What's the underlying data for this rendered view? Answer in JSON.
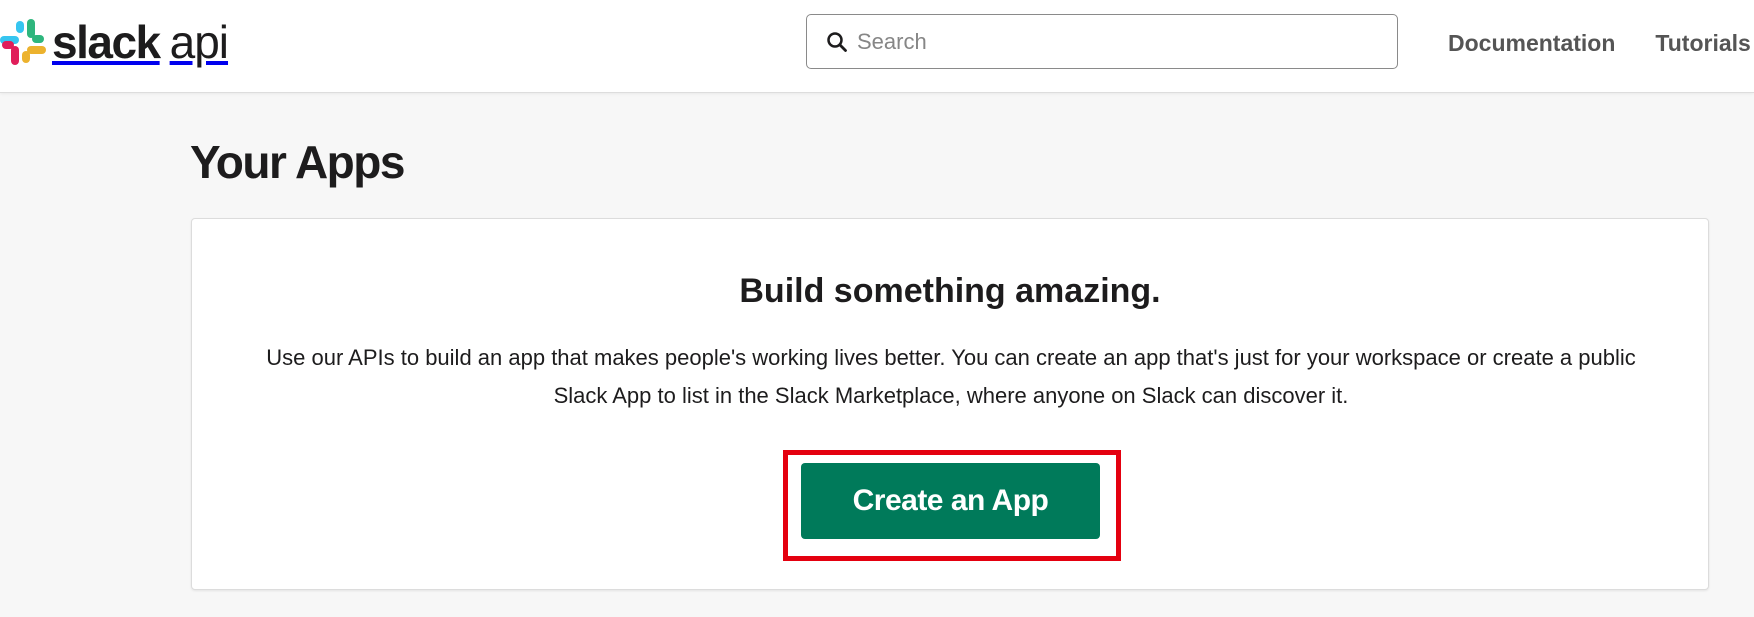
{
  "header": {
    "logo": {
      "word_slack": "slack",
      "word_api": "api",
      "colors": [
        "#36c5f0",
        "#2eb67d",
        "#ecb22e",
        "#e01e5a"
      ]
    },
    "search": {
      "placeholder": "Search",
      "value": "",
      "icon": "search-icon"
    },
    "nav": [
      {
        "label": "Documentation"
      },
      {
        "label": "Tutorials"
      }
    ]
  },
  "main": {
    "page_title": "Your Apps",
    "card": {
      "heading": "Build something amazing.",
      "body": "Use our APIs to build an app that makes people's working lives better. You can create an app that's just for your workspace or create a public Slack App to list in the Slack Marketplace, where anyone on Slack can discover it.",
      "cta_label": "Create an App"
    }
  },
  "colors": {
    "button_green": "#007a5a",
    "highlight_red": "#e4000f",
    "page_background": "#f7f7f7"
  }
}
